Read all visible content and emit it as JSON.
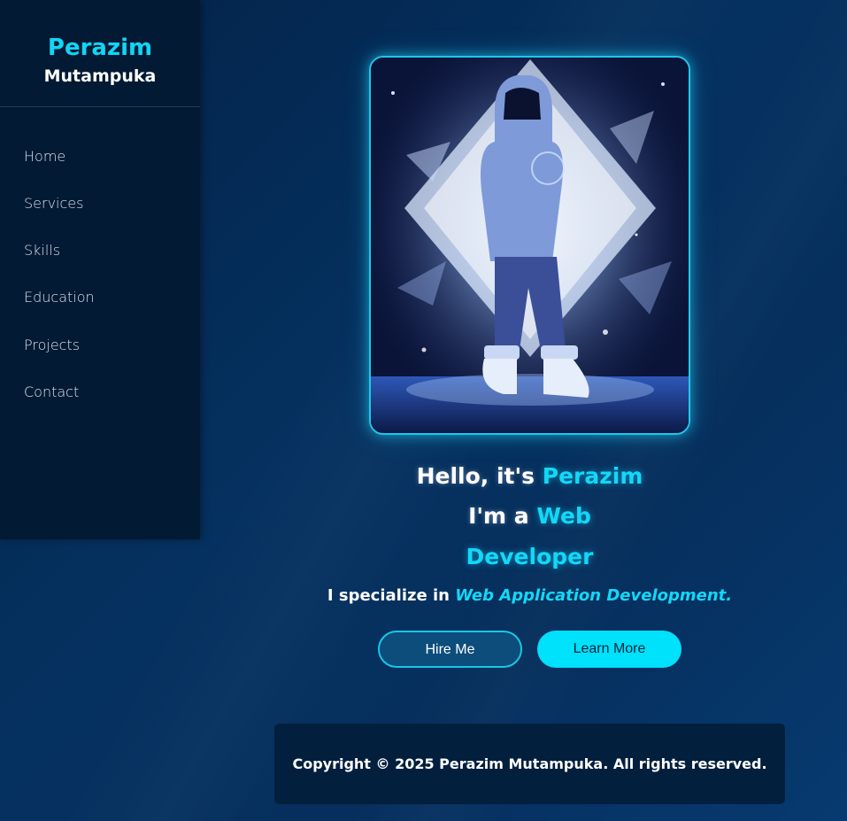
{
  "brand": {
    "first_name": "Perazim",
    "last_name": "Mutampuka"
  },
  "nav": {
    "items": [
      {
        "label": "Home"
      },
      {
        "label": "Services"
      },
      {
        "label": "Skills"
      },
      {
        "label": "Education"
      },
      {
        "label": "Projects"
      },
      {
        "label": "Contact"
      }
    ]
  },
  "hero": {
    "greeting_prefix": "Hello, it's",
    "greeting_name": "Perazim",
    "role_prefix": "I'm a",
    "role_word1": "Web",
    "role_word2": "Developer",
    "specialize_prefix": "I specialize in",
    "specialize_field": "Web Application Development."
  },
  "buttons": {
    "hire_label": "Hire Me",
    "learn_label": "Learn More"
  },
  "footer": {
    "copyright": "Copyright © 2025 Perazim Mutampuka. All rights reserved."
  },
  "colors": {
    "accent": "#12d8f8",
    "sidebar_bg": "#021a33",
    "page_bg": "#053160"
  }
}
